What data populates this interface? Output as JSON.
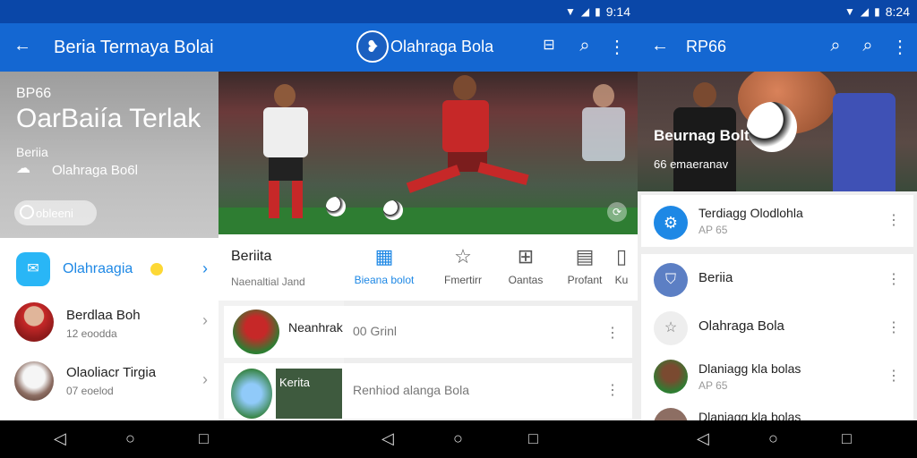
{
  "status": {
    "time_left": "9:14",
    "time_right": "8:24"
  },
  "screen1": {
    "title": "Beria Termaya Bolai",
    "hero": {
      "eyebrow": "BP66",
      "headline": "OarBaiía Terlak",
      "sub1": "Beriia",
      "sub2": "Olahraga Bo6l",
      "chip": "obleeni"
    },
    "rows": [
      {
        "title": "Olahraagia",
        "sub": ""
      },
      {
        "title": "Berdlaa Boh",
        "sub": "12 eoodda"
      },
      {
        "title": "Olaoliacr Tirgia",
        "sub": "07 eoelod"
      }
    ]
  },
  "screen2": {
    "brand": "Olahraga Bola",
    "featured_title": "Beriita",
    "featured_sub": "Naenaltial Jand",
    "tabs": [
      "Bieana bolot",
      "Fmertirr",
      "Oantas",
      "Profant",
      "Ku"
    ],
    "items": [
      {
        "title": "Neanhrak",
        "snippet": "00 Grinl"
      },
      {
        "title": "Kerita",
        "snippet": "Renhiod alanga Bola"
      }
    ]
  },
  "screen3": {
    "title": "RP66",
    "hero_title": "Beurnag Bolt",
    "hero_sub": "66 emaeranav",
    "top_card": {
      "title": "Terdiagg Olodlohla",
      "sub": "AP 65"
    },
    "rows": [
      {
        "title": "Beriia",
        "sub": ""
      },
      {
        "title": "Olahraga Bola",
        "sub": ""
      },
      {
        "title": "Dlaniagg kla bolas",
        "sub": "AP 65"
      },
      {
        "title": "Dlaniagg kla bolas",
        "sub": ""
      }
    ]
  },
  "colors": {
    "appbar": "#1467d2",
    "statusbar": "#0a47a8",
    "accent": "#1e88e5"
  }
}
